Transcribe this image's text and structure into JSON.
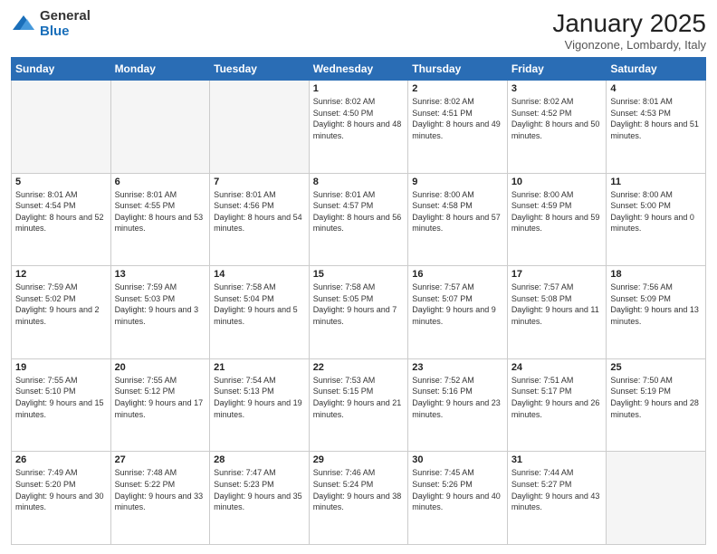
{
  "logo": {
    "general": "General",
    "blue": "Blue"
  },
  "header": {
    "month": "January 2025",
    "location": "Vigonzone, Lombardy, Italy"
  },
  "days_of_week": [
    "Sunday",
    "Monday",
    "Tuesday",
    "Wednesday",
    "Thursday",
    "Friday",
    "Saturday"
  ],
  "weeks": [
    [
      {
        "day": "",
        "sunrise": "",
        "sunset": "",
        "daylight": "",
        "empty": true
      },
      {
        "day": "",
        "sunrise": "",
        "sunset": "",
        "daylight": "",
        "empty": true
      },
      {
        "day": "",
        "sunrise": "",
        "sunset": "",
        "daylight": "",
        "empty": true
      },
      {
        "day": "1",
        "sunrise": "Sunrise: 8:02 AM",
        "sunset": "Sunset: 4:50 PM",
        "daylight": "Daylight: 8 hours and 48 minutes."
      },
      {
        "day": "2",
        "sunrise": "Sunrise: 8:02 AM",
        "sunset": "Sunset: 4:51 PM",
        "daylight": "Daylight: 8 hours and 49 minutes."
      },
      {
        "day": "3",
        "sunrise": "Sunrise: 8:02 AM",
        "sunset": "Sunset: 4:52 PM",
        "daylight": "Daylight: 8 hours and 50 minutes."
      },
      {
        "day": "4",
        "sunrise": "Sunrise: 8:01 AM",
        "sunset": "Sunset: 4:53 PM",
        "daylight": "Daylight: 8 hours and 51 minutes."
      }
    ],
    [
      {
        "day": "5",
        "sunrise": "Sunrise: 8:01 AM",
        "sunset": "Sunset: 4:54 PM",
        "daylight": "Daylight: 8 hours and 52 minutes."
      },
      {
        "day": "6",
        "sunrise": "Sunrise: 8:01 AM",
        "sunset": "Sunset: 4:55 PM",
        "daylight": "Daylight: 8 hours and 53 minutes."
      },
      {
        "day": "7",
        "sunrise": "Sunrise: 8:01 AM",
        "sunset": "Sunset: 4:56 PM",
        "daylight": "Daylight: 8 hours and 54 minutes."
      },
      {
        "day": "8",
        "sunrise": "Sunrise: 8:01 AM",
        "sunset": "Sunset: 4:57 PM",
        "daylight": "Daylight: 8 hours and 56 minutes."
      },
      {
        "day": "9",
        "sunrise": "Sunrise: 8:00 AM",
        "sunset": "Sunset: 4:58 PM",
        "daylight": "Daylight: 8 hours and 57 minutes."
      },
      {
        "day": "10",
        "sunrise": "Sunrise: 8:00 AM",
        "sunset": "Sunset: 4:59 PM",
        "daylight": "Daylight: 8 hours and 59 minutes."
      },
      {
        "day": "11",
        "sunrise": "Sunrise: 8:00 AM",
        "sunset": "Sunset: 5:00 PM",
        "daylight": "Daylight: 9 hours and 0 minutes."
      }
    ],
    [
      {
        "day": "12",
        "sunrise": "Sunrise: 7:59 AM",
        "sunset": "Sunset: 5:02 PM",
        "daylight": "Daylight: 9 hours and 2 minutes."
      },
      {
        "day": "13",
        "sunrise": "Sunrise: 7:59 AM",
        "sunset": "Sunset: 5:03 PM",
        "daylight": "Daylight: 9 hours and 3 minutes."
      },
      {
        "day": "14",
        "sunrise": "Sunrise: 7:58 AM",
        "sunset": "Sunset: 5:04 PM",
        "daylight": "Daylight: 9 hours and 5 minutes."
      },
      {
        "day": "15",
        "sunrise": "Sunrise: 7:58 AM",
        "sunset": "Sunset: 5:05 PM",
        "daylight": "Daylight: 9 hours and 7 minutes."
      },
      {
        "day": "16",
        "sunrise": "Sunrise: 7:57 AM",
        "sunset": "Sunset: 5:07 PM",
        "daylight": "Daylight: 9 hours and 9 minutes."
      },
      {
        "day": "17",
        "sunrise": "Sunrise: 7:57 AM",
        "sunset": "Sunset: 5:08 PM",
        "daylight": "Daylight: 9 hours and 11 minutes."
      },
      {
        "day": "18",
        "sunrise": "Sunrise: 7:56 AM",
        "sunset": "Sunset: 5:09 PM",
        "daylight": "Daylight: 9 hours and 13 minutes."
      }
    ],
    [
      {
        "day": "19",
        "sunrise": "Sunrise: 7:55 AM",
        "sunset": "Sunset: 5:10 PM",
        "daylight": "Daylight: 9 hours and 15 minutes."
      },
      {
        "day": "20",
        "sunrise": "Sunrise: 7:55 AM",
        "sunset": "Sunset: 5:12 PM",
        "daylight": "Daylight: 9 hours and 17 minutes."
      },
      {
        "day": "21",
        "sunrise": "Sunrise: 7:54 AM",
        "sunset": "Sunset: 5:13 PM",
        "daylight": "Daylight: 9 hours and 19 minutes."
      },
      {
        "day": "22",
        "sunrise": "Sunrise: 7:53 AM",
        "sunset": "Sunset: 5:15 PM",
        "daylight": "Daylight: 9 hours and 21 minutes."
      },
      {
        "day": "23",
        "sunrise": "Sunrise: 7:52 AM",
        "sunset": "Sunset: 5:16 PM",
        "daylight": "Daylight: 9 hours and 23 minutes."
      },
      {
        "day": "24",
        "sunrise": "Sunrise: 7:51 AM",
        "sunset": "Sunset: 5:17 PM",
        "daylight": "Daylight: 9 hours and 26 minutes."
      },
      {
        "day": "25",
        "sunrise": "Sunrise: 7:50 AM",
        "sunset": "Sunset: 5:19 PM",
        "daylight": "Daylight: 9 hours and 28 minutes."
      }
    ],
    [
      {
        "day": "26",
        "sunrise": "Sunrise: 7:49 AM",
        "sunset": "Sunset: 5:20 PM",
        "daylight": "Daylight: 9 hours and 30 minutes."
      },
      {
        "day": "27",
        "sunrise": "Sunrise: 7:48 AM",
        "sunset": "Sunset: 5:22 PM",
        "daylight": "Daylight: 9 hours and 33 minutes."
      },
      {
        "day": "28",
        "sunrise": "Sunrise: 7:47 AM",
        "sunset": "Sunset: 5:23 PM",
        "daylight": "Daylight: 9 hours and 35 minutes."
      },
      {
        "day": "29",
        "sunrise": "Sunrise: 7:46 AM",
        "sunset": "Sunset: 5:24 PM",
        "daylight": "Daylight: 9 hours and 38 minutes."
      },
      {
        "day": "30",
        "sunrise": "Sunrise: 7:45 AM",
        "sunset": "Sunset: 5:26 PM",
        "daylight": "Daylight: 9 hours and 40 minutes."
      },
      {
        "day": "31",
        "sunrise": "Sunrise: 7:44 AM",
        "sunset": "Sunset: 5:27 PM",
        "daylight": "Daylight: 9 hours and 43 minutes."
      },
      {
        "day": "",
        "sunrise": "",
        "sunset": "",
        "daylight": "",
        "empty": true
      }
    ]
  ]
}
